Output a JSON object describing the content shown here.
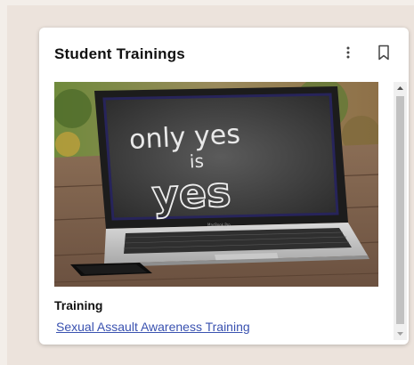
{
  "card": {
    "title": "Student Trainings",
    "section_label": "Training",
    "training_link": "Sexual Assault Awareness Training"
  },
  "image": {
    "screen_text_line1": "only yes",
    "screen_text_line2": "is",
    "screen_text_line3": "yes",
    "laptop_brand": "MacBook Pro"
  },
  "icons": {
    "more": "more-vertical-icon",
    "bookmark": "bookmark-icon"
  },
  "colors": {
    "background": "#ece3dc",
    "card": "#ffffff",
    "link": "#3a52b0",
    "title": "#111111"
  }
}
